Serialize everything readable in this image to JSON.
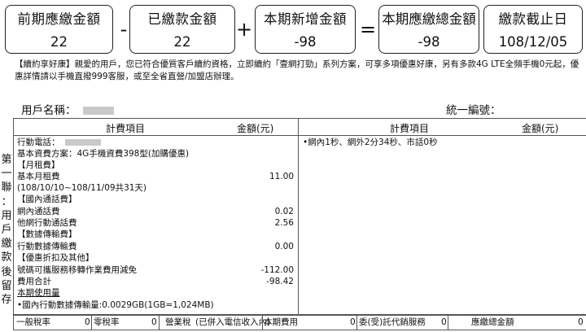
{
  "summary": {
    "previous_due": {
      "label": "前期應繳金額",
      "value": "22"
    },
    "paid": {
      "label": "已繳款金額",
      "value": "22"
    },
    "new_charges": {
      "label": "本期新增金額",
      "value": "-98"
    },
    "total_due": {
      "label": "本期應繳總金額",
      "value": "-98"
    },
    "due_date": {
      "label": "繳款截止日",
      "value": "108/12/05"
    },
    "minus_op": "-",
    "plus_op": "+",
    "equals_op": "="
  },
  "notice": {
    "line1": "【續約享好康】親愛的用戶，您已符合優質客戶續約資格，立即續約「壹網打勁」系列方案，可享多項優惠好康，另有多款4G LTE全頻手機0元起，優",
    "line2": "惠詳情請以手機直撥999客服，或至全省直營/加盟店辦理。"
  },
  "customer": {
    "name_label": "用戶名稱：",
    "id_label": "統一編號："
  },
  "side_label": [
    "第",
    "一",
    "聯",
    "：",
    "用",
    "戶",
    "繳",
    "款",
    "後",
    "留",
    "存"
  ],
  "table": {
    "col_item": "計費項目",
    "col_amount": "金額(元)",
    "left_rows": [
      {
        "text": "行動電話：",
        "amount": "",
        "blur": true
      },
      {
        "text": "基本資費方案：4G手機資費398型(加購優惠)",
        "amount": ""
      },
      {
        "text": "【月租費】",
        "amount": ""
      },
      {
        "text": "基本月租費",
        "amount": "11.00"
      },
      {
        "text": "(108/10/10~108/11/09共31天)",
        "amount": ""
      },
      {
        "text": "【國內通話費】",
        "amount": ""
      },
      {
        "text": "網內通話費",
        "amount": "0.02"
      },
      {
        "text": "他網行動通話費",
        "amount": "2.56"
      },
      {
        "text": "【數據傳輸費】",
        "amount": ""
      },
      {
        "text": "行動數據傳輸費",
        "amount": "0.00"
      },
      {
        "text": "【優惠折扣及其他】",
        "amount": ""
      },
      {
        "text": "號碼可攜服務移轉作業費用減免",
        "amount": "-112.00"
      },
      {
        "text": "費用合計",
        "amount": "-98.42"
      },
      {
        "text": "本期使用量",
        "amount": "",
        "underline": true
      },
      {
        "text": "•國內行動數據傳輸量:0.0029GB(1GB=1,024MB)",
        "amount": ""
      }
    ],
    "right_note": "•網內1秒、網外2分34秒、市話0秒"
  },
  "tax_row": {
    "general_tax": "一般稅率",
    "general_tax_value": "0",
    "zero_tax": "零稅率",
    "zero_tax_value": "0",
    "business_tax": "營業稅",
    "included_note": "(已併入電信收入內)",
    "this_period_fee": "本期費用",
    "this_period_fee_value": "0",
    "agency_service": "委(受)託代銷服務",
    "agency_service_value": "0",
    "amount_due": "應繳總金額",
    "amount_due_value": "0"
  }
}
